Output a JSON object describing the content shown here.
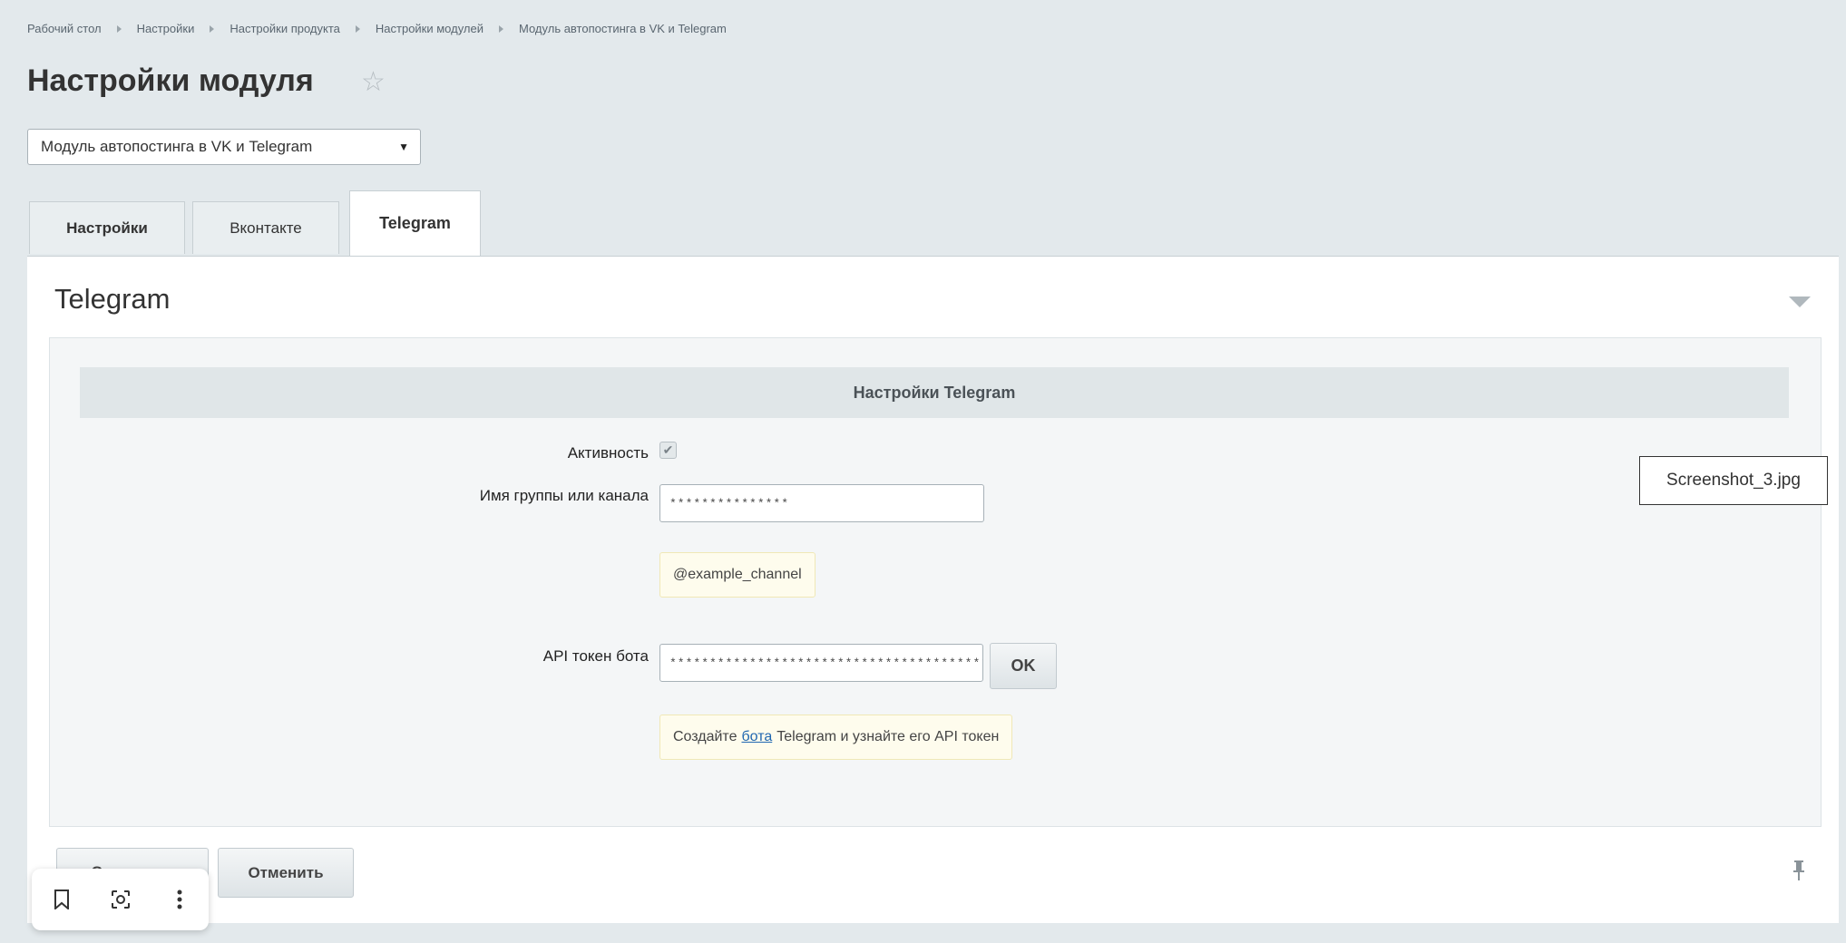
{
  "breadcrumb": [
    {
      "label": "Рабочий стол"
    },
    {
      "label": "Настройки"
    },
    {
      "label": "Настройки продукта"
    },
    {
      "label": "Настройки модулей"
    },
    {
      "label": "Модуль автопостинга в VK и Telegram"
    }
  ],
  "page": {
    "title": "Настройки модуля"
  },
  "module_select": {
    "selected": "Модуль автопостинга в VK и Telegram"
  },
  "tabs": [
    {
      "label": "Настройки",
      "active": false
    },
    {
      "label": "Вконтакте",
      "active": false
    },
    {
      "label": "Telegram",
      "active": true
    }
  ],
  "section": {
    "title": "Telegram",
    "header": "Настройки Telegram",
    "fields": {
      "active": {
        "label": "Активность",
        "checked": true
      },
      "group": {
        "label": "Имя группы или канала",
        "value": "***************",
        "hint": "@example_channel"
      },
      "token": {
        "label": "API токен бота",
        "value": "*****************************************",
        "ok_label": "OK",
        "hint_before": "Создайте",
        "hint_link": "бота",
        "hint_after": "Telegram и узнайте его API токен"
      }
    }
  },
  "actions": {
    "save_label": "Сохранить",
    "cancel_label": "Отменить"
  },
  "overlay": {
    "file_label": "Screenshot_3.jpg"
  },
  "icons": {
    "star": "star-icon",
    "pin": "pin-icon",
    "collapse": "triangle-down-icon",
    "bookmark": "bookmark-icon",
    "lens": "lens-icon",
    "more": "more-vertical-icon"
  }
}
